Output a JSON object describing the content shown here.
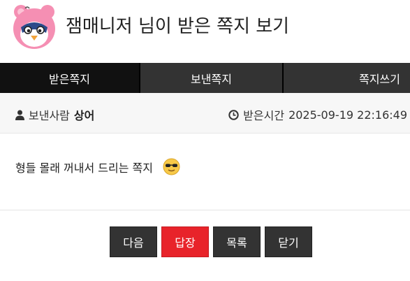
{
  "header": {
    "title": "잼매니저 님이 받은 쪽지 보기",
    "avatar_icon": "pink-bear-mascot-avatar"
  },
  "tabs": [
    {
      "label": "받은쪽지",
      "active": true
    },
    {
      "label": "보낸쪽지",
      "active": false
    },
    {
      "label": "쪽지쓰기",
      "active": false
    }
  ],
  "info": {
    "sender_label": "보낸사람",
    "sender_name": "상어",
    "received_label": "받은시간",
    "received_time": "2025-09-19 22:16:49",
    "sender_icon": "user-icon",
    "received_icon": "clock-icon"
  },
  "message": {
    "text": "형들 몰래 꺼내서 드리는 쪽지",
    "emoji_icon": "sunglasses-emoji-icon"
  },
  "buttons": {
    "next": "다음",
    "reply": "답장",
    "list": "목록",
    "close": "닫기"
  },
  "colors": {
    "reply_button": "#e8232a",
    "dark_button": "#333333",
    "tab_active": "#111111",
    "tab_inactive": "#333333"
  }
}
